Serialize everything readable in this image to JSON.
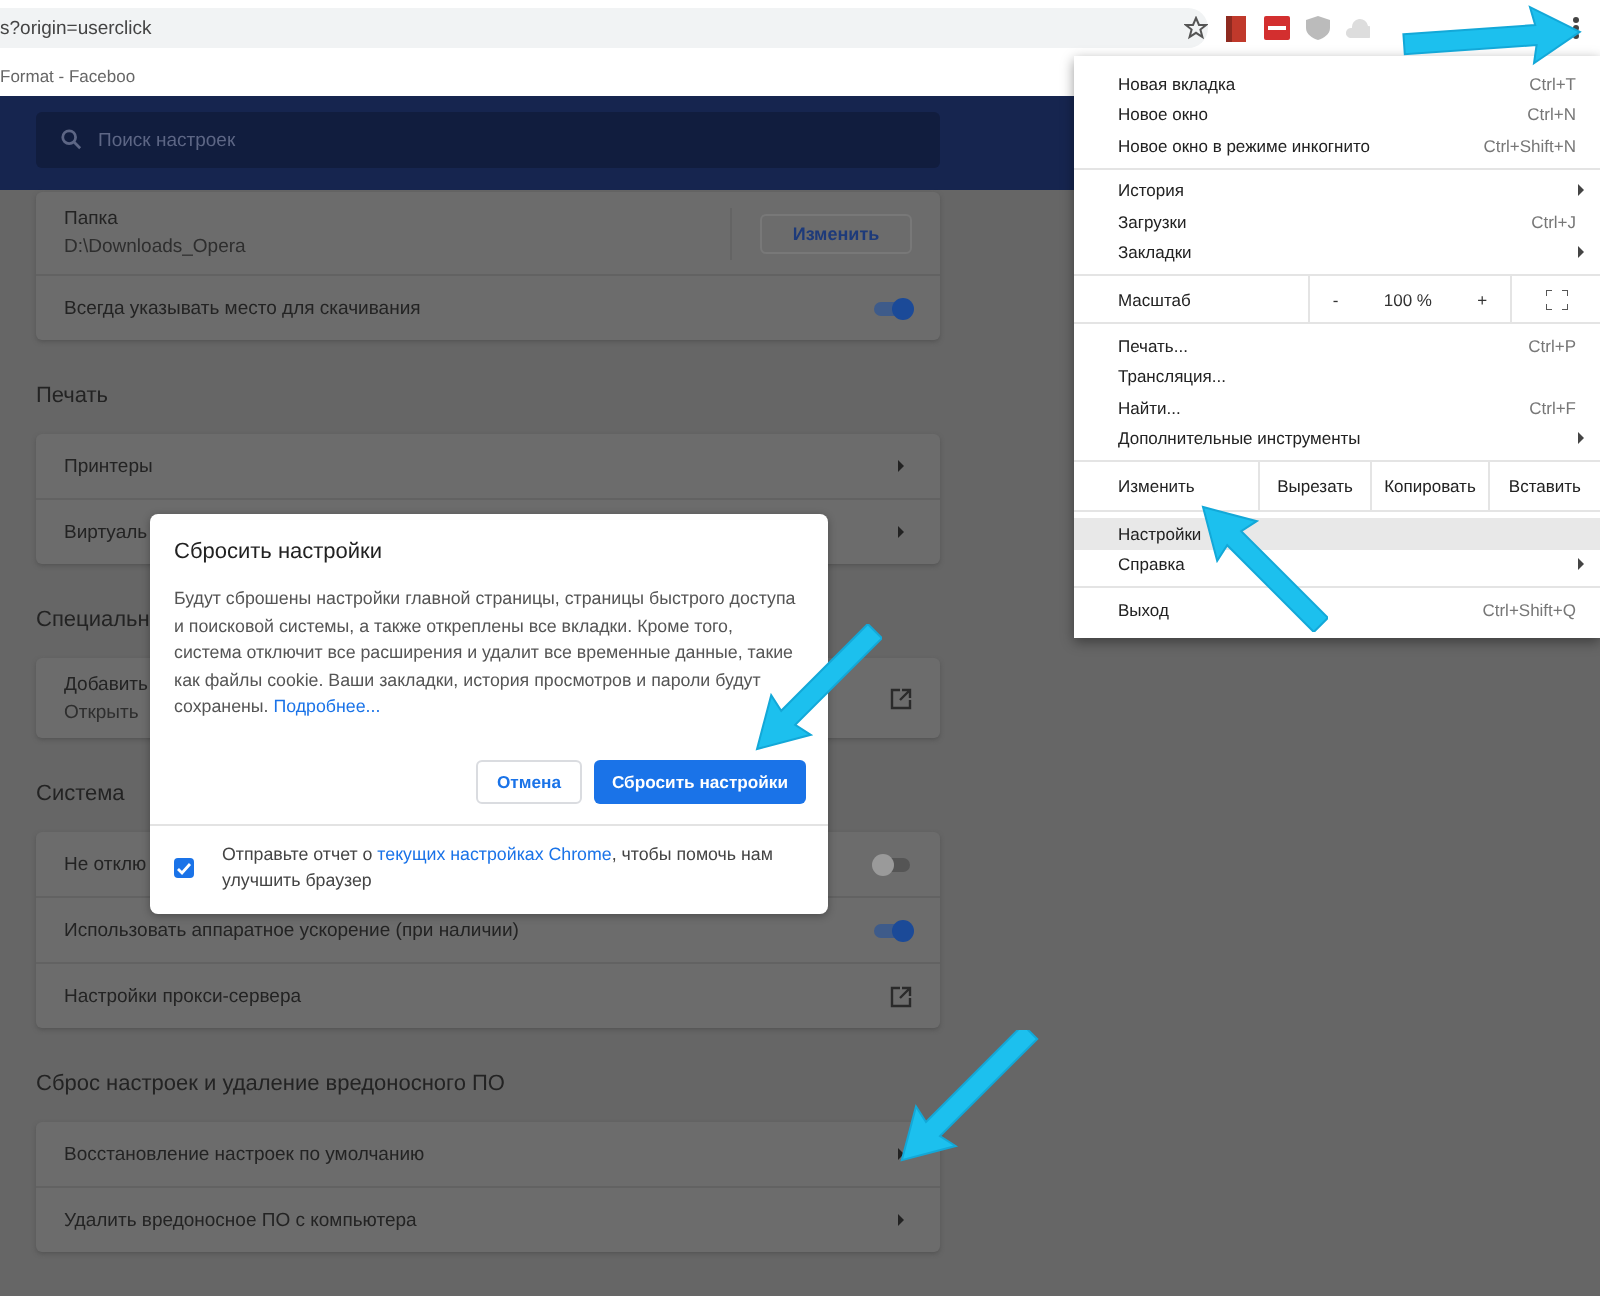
{
  "toolbar": {
    "url": "s?origin=userclick",
    "bookmark": "Format - Faceboo"
  },
  "search": {
    "placeholder": "Поиск настроек"
  },
  "sections": [
    {
      "rows": [
        {
          "kind": "folder",
          "label": "Папка",
          "value": "D:\\Downloads_Opera",
          "button": "Изменить"
        },
        {
          "kind": "toggle",
          "label": "Всегда указывать место для скачивания",
          "on": true
        }
      ]
    },
    {
      "title": "Печать",
      "rows": [
        {
          "kind": "arrow",
          "label": "Принтеры"
        },
        {
          "kind": "arrow",
          "label": "Виртуаль"
        }
      ]
    },
    {
      "title": "Специальн",
      "rows": [
        {
          "kind": "external",
          "label": "Добавить",
          "value": "Открыть"
        }
      ]
    },
    {
      "title": "Система",
      "rows": [
        {
          "kind": "toggle",
          "label": "Не отклю",
          "on": false
        },
        {
          "kind": "toggle",
          "label": "Использовать аппаратное ускорение (при наличии)",
          "on": true
        },
        {
          "kind": "external",
          "label": "Настройки прокси-сервера"
        }
      ]
    },
    {
      "title": "Сброс настроек и удаление вредоносного ПО",
      "rows": [
        {
          "kind": "arrow",
          "label": "Восстановление настроек по умолчанию"
        },
        {
          "kind": "arrow",
          "label": "Удалить вредоносное ПО с компьютера"
        }
      ]
    }
  ],
  "menu": [
    {
      "kind": "items",
      "items": [
        {
          "label": "Новая вкладка",
          "shortcut": "Ctrl+T",
          "submenu": false,
          "selected": false
        },
        {
          "label": "Новое окно",
          "shortcut": "Ctrl+N",
          "submenu": false,
          "selected": false
        },
        {
          "label": "Новое окно в режиме инкогнито",
          "shortcut": "Ctrl+Shift+N",
          "submenu": false,
          "selected": false
        }
      ]
    },
    {
      "kind": "items",
      "items": [
        {
          "label": "История",
          "submenu": true,
          "selected": false
        },
        {
          "label": "Загрузки",
          "shortcut": "Ctrl+J",
          "submenu": false,
          "selected": false
        },
        {
          "label": "Закладки",
          "submenu": true,
          "selected": false
        }
      ]
    },
    {
      "kind": "zoom",
      "label": "Масштаб",
      "minus": "-",
      "value": "100 %",
      "plus": "+"
    },
    {
      "kind": "items",
      "items": [
        {
          "label": "Печать...",
          "shortcut": "Ctrl+P",
          "submenu": false,
          "selected": false
        },
        {
          "label": "Трансляция...",
          "submenu": false,
          "selected": false
        },
        {
          "label": "Найти...",
          "shortcut": "Ctrl+F",
          "submenu": false,
          "selected": false
        },
        {
          "label": "Дополнительные инструменты",
          "submenu": true,
          "selected": false
        }
      ]
    },
    {
      "kind": "edit",
      "label": "Изменить",
      "buttons": [
        "Вырезать",
        "Копировать",
        "Вставить"
      ]
    },
    {
      "kind": "items",
      "items": [
        {
          "label": "Настройки",
          "submenu": false,
          "selected": true
        },
        {
          "label": "Справка",
          "submenu": true,
          "selected": false
        }
      ]
    },
    {
      "kind": "items",
      "items": [
        {
          "label": "Выход",
          "shortcut": "Ctrl+Shift+Q",
          "submenu": false,
          "selected": false
        }
      ]
    }
  ],
  "dialog": {
    "title": "Сбросить настройки",
    "body": "Будут сброшены настройки главной страницы, страницы быстрого доступа и поисковой системы, а также откреплены все вкладки. Кроме того, система отключит все расширения и удалит все временные данные, такие как файлы cookie. Ваши закладки, история просмотров и пароли будут сохранены.",
    "more_link": "Подробнее...",
    "cancel": "Отмена",
    "confirm": "Сбросить настройки",
    "report": {
      "checked": true,
      "before": "Отправьте отчет о",
      "link": "текущих настройках Chrome",
      "after": ", чтобы помочь нам улучшить браузер"
    }
  }
}
